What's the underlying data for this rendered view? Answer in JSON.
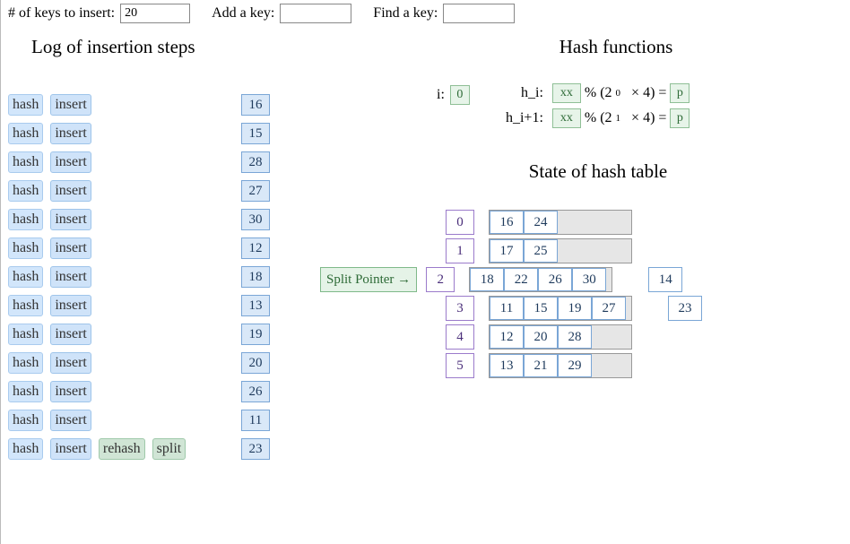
{
  "controls": {
    "keys_label": "# of keys to insert:",
    "keys_value": "20",
    "add_label": "Add a key:",
    "add_value": "",
    "find_label": "Find a key:",
    "find_value": ""
  },
  "headings": {
    "log": "Log of insertion steps",
    "hashfns": "Hash functions",
    "state": "State of hash table"
  },
  "hashfns": {
    "i_label": "i:",
    "i_value": "0",
    "rows": [
      {
        "label": "h_i:",
        "xx": "xx",
        "pct": "% (2",
        "exp": "0",
        "mult": "× 4) =",
        "p": "p"
      },
      {
        "label": "h_i+1:",
        "xx": "xx",
        "pct": "% (2",
        "exp": "1",
        "mult": "× 4) =",
        "p": "p"
      }
    ]
  },
  "log": [
    {
      "tags": [
        "hash",
        "insert"
      ],
      "value": "16"
    },
    {
      "tags": [
        "hash",
        "insert"
      ],
      "value": "15"
    },
    {
      "tags": [
        "hash",
        "insert"
      ],
      "value": "28"
    },
    {
      "tags": [
        "hash",
        "insert"
      ],
      "value": "27"
    },
    {
      "tags": [
        "hash",
        "insert"
      ],
      "value": "30"
    },
    {
      "tags": [
        "hash",
        "insert"
      ],
      "value": "12"
    },
    {
      "tags": [
        "hash",
        "insert"
      ],
      "value": "18"
    },
    {
      "tags": [
        "hash",
        "insert"
      ],
      "value": "13"
    },
    {
      "tags": [
        "hash",
        "insert"
      ],
      "value": "19"
    },
    {
      "tags": [
        "hash",
        "insert"
      ],
      "value": "20"
    },
    {
      "tags": [
        "hash",
        "insert"
      ],
      "value": "26"
    },
    {
      "tags": [
        "hash",
        "insert"
      ],
      "value": "11"
    },
    {
      "tags": [
        "hash",
        "insert",
        "rehash",
        "split"
      ],
      "value": "23"
    }
  ],
  "table": {
    "split_label": "Split Pointer →",
    "split_row": 2,
    "primary_capacity": 4,
    "buckets": [
      {
        "idx": "0",
        "primary": [
          "16",
          "24"
        ],
        "overflow": []
      },
      {
        "idx": "1",
        "primary": [
          "17",
          "25"
        ],
        "overflow": []
      },
      {
        "idx": "2",
        "primary": [
          "18",
          "22",
          "26",
          "30"
        ],
        "overflow": [
          "14"
        ]
      },
      {
        "idx": "3",
        "primary": [
          "11",
          "15",
          "19",
          "27"
        ],
        "overflow": [
          "23"
        ]
      },
      {
        "idx": "4",
        "primary": [
          "12",
          "20",
          "28"
        ],
        "overflow": []
      },
      {
        "idx": "5",
        "primary": [
          "13",
          "21",
          "29"
        ],
        "overflow": []
      }
    ]
  }
}
